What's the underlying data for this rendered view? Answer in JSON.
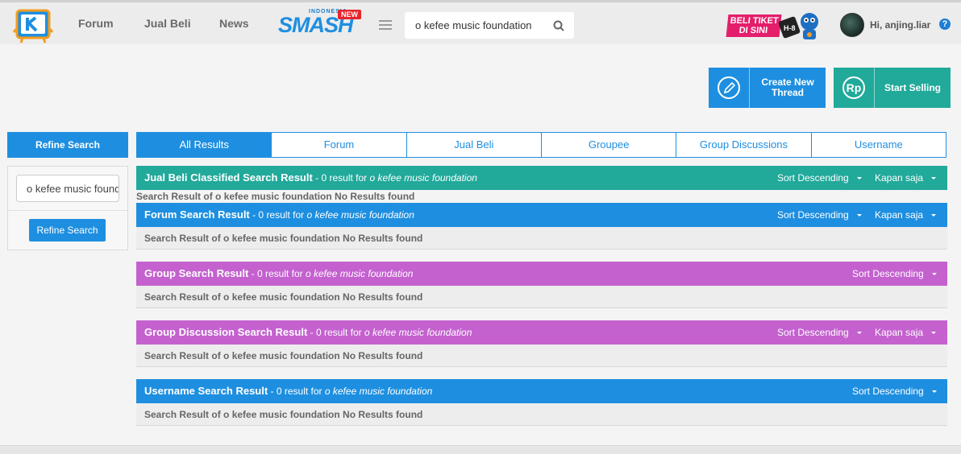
{
  "nav": {
    "links": [
      "Forum",
      "Jual Beli",
      "News"
    ],
    "smash": {
      "small": "INDONESIA",
      "big": "SMASH",
      "badge": "NEW"
    },
    "search_value": "o kefee music foundation",
    "promo_line1": "BELI TIKET",
    "promo_line2": "DI SINI",
    "promo_badge": "H-8",
    "greeting": "Hi, anjing.liar",
    "help": "?"
  },
  "actions": {
    "create_line1": "Create New",
    "create_line2": "Thread",
    "sell": "Start Selling",
    "rp": "Rp"
  },
  "refine": {
    "title": "Refine Search",
    "input_value": "o kefee music foundation",
    "button": "Refine Search"
  },
  "tabs": [
    "All Results",
    "Forum",
    "Jual Beli",
    "Groupee",
    "Group Discussions",
    "Username"
  ],
  "results": {
    "jualbeli": {
      "title": "Jual Beli Classified Search Result",
      "sub": " - 0 result for ",
      "query": "o kefee music foundation",
      "sort": "Sort Descending",
      "time": "Kapan saja",
      "message": "Search Result of o kefee music foundation No Results found"
    },
    "forum": {
      "title": "Forum Search Result",
      "sub": " - 0 result for ",
      "query": "o kefee music foundation",
      "sort": "Sort Descending",
      "time": "Kapan saja",
      "message": "Search Result of o kefee music foundation No Results found"
    },
    "group": {
      "title": "Group Search Result",
      "sub": " - 0 result for ",
      "query": "o kefee music foundation",
      "sort": "Sort Descending",
      "message": "Search Result of o kefee music foundation No Results found"
    },
    "groupdisc": {
      "title": "Group Discussion Search Result",
      "sub": " - 0 result for ",
      "query": "o kefee music foundation",
      "sort": "Sort Descending",
      "time": "Kapan saja",
      "message": "Search Result of o kefee music foundation No Results found"
    },
    "username": {
      "title": "Username Search Result",
      "sub": " - 0 result for ",
      "query": "o kefee music foundation",
      "sort": "Sort Descending",
      "message": "Search Result of o kefee music foundation No Results found"
    }
  },
  "colors": {
    "blue": "#1e8fe0",
    "teal": "#21a99a",
    "purple": "#c461cf",
    "promo": "#e41e6b"
  },
  "icons": [
    "kaskus-logo",
    "menu-icon",
    "search-icon",
    "pencil-icon",
    "rupiah-icon",
    "help-icon",
    "caret-down-icon"
  ]
}
